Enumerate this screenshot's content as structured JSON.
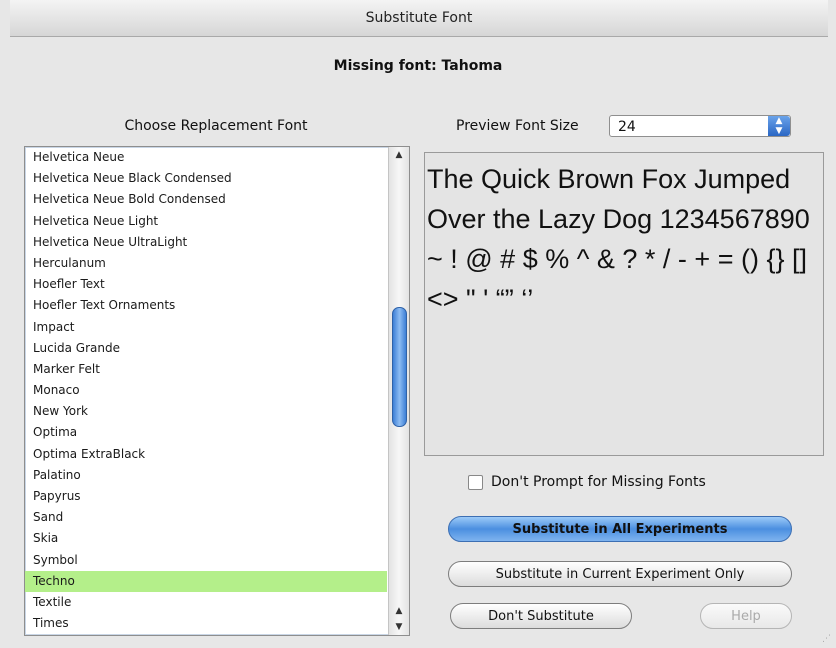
{
  "window": {
    "title": "Substitute Font"
  },
  "missing_font": "Missing font: Tahoma",
  "choose_label": "Choose Replacement Font",
  "font_list": [
    "Helvetica Neue",
    "Helvetica Neue Black Condensed",
    "Helvetica Neue Bold Condensed",
    "Helvetica Neue Light",
    "Helvetica Neue UltraLight",
    "Herculanum",
    "Hoefler Text",
    "Hoefler Text Ornaments",
    "Impact",
    "Lucida Grande",
    "Marker Felt",
    "Monaco",
    "New York",
    "Optima",
    "Optima ExtraBlack",
    "Palatino",
    "Papyrus",
    "Sand",
    "Skia",
    "Symbol",
    "Techno",
    "Textile",
    "Times"
  ],
  "selected_font": "Techno",
  "preview": {
    "size_label": "Preview Font Size",
    "size_value": "24",
    "sample_text": "The Quick Brown Fox Jumped Over the Lazy Dog 1234567890 ~ ! @ # $ % ^ & ? * / - + = () {} [] <> \" ' “” ‘’"
  },
  "checkbox": {
    "label": "Don't Prompt for Missing Fonts",
    "checked": false
  },
  "buttons": {
    "all": "Substitute in All Experiments",
    "current": "Substitute in Current Experiment Only",
    "dont": "Don't Substitute",
    "help": "Help"
  },
  "colors": {
    "selection": "#b4ef8a",
    "accent": "#4b8fe0"
  }
}
